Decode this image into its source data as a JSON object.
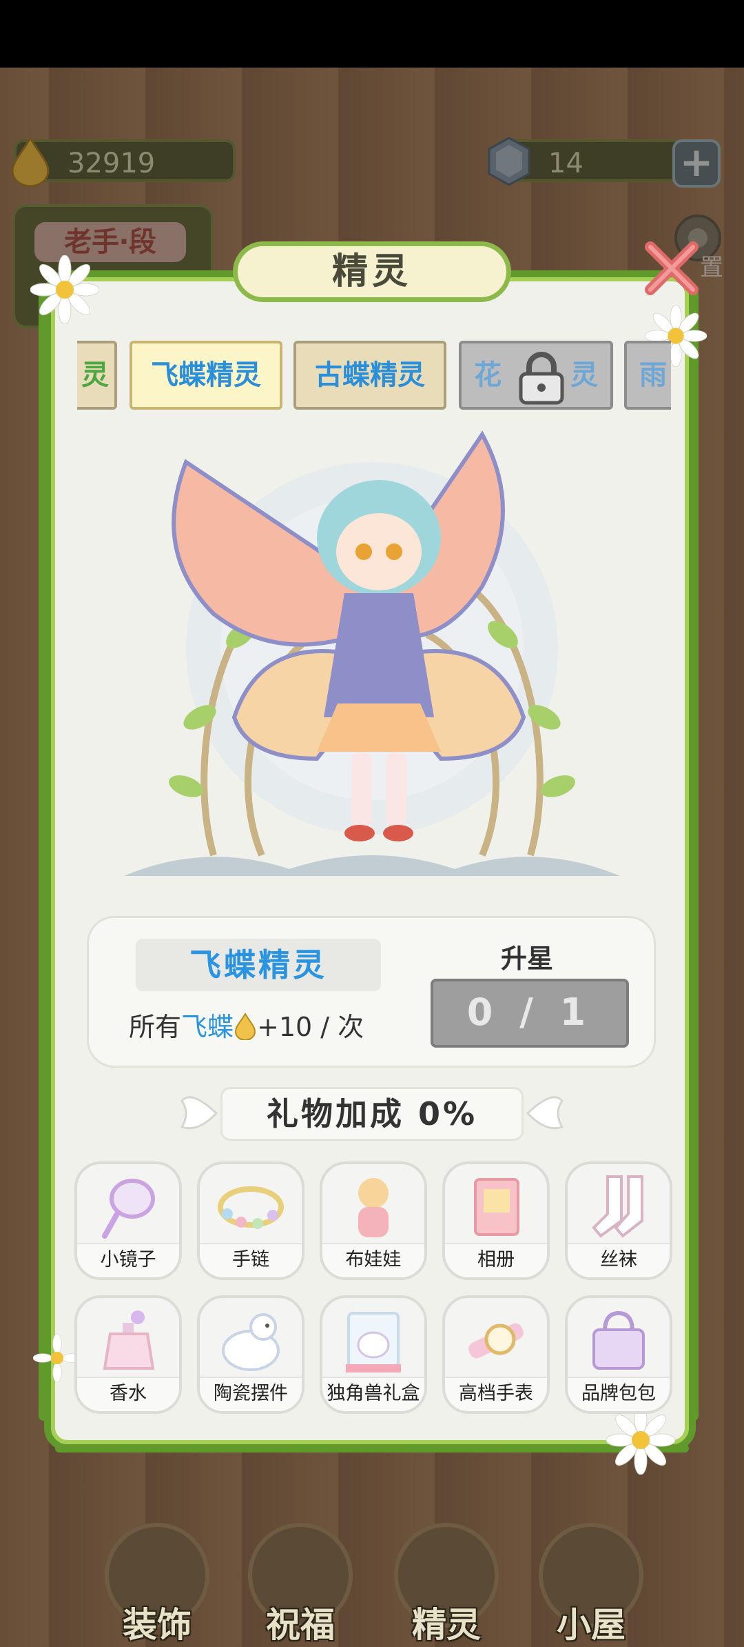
{
  "hud": {
    "gold_value": "32919",
    "gem_value": "14",
    "plus_label": "+",
    "banner_label": "老手",
    "banner_label_suffix": "段",
    "settings_label": "置"
  },
  "panel": {
    "title": "精灵",
    "tabs": [
      {
        "label": "灵",
        "state": "partial"
      },
      {
        "label": "飞蝶精灵",
        "state": "active"
      },
      {
        "label": "古蝶精灵",
        "state": "normal"
      },
      {
        "label": "花",
        "label_end": "灵",
        "state": "locked"
      },
      {
        "label": "雨",
        "state": "partial"
      }
    ]
  },
  "info": {
    "name": "飞蝶精灵",
    "bonus_prefix": "所有",
    "bonus_target": "飞蝶",
    "bonus_suffix": "+10 / 次",
    "star_label": "升星",
    "star_progress": "0 / 1"
  },
  "gifts": {
    "header": "礼物加成 0%",
    "items": [
      {
        "label": "小镜子",
        "icon": "mirror-icon"
      },
      {
        "label": "手链",
        "icon": "bracelet-icon"
      },
      {
        "label": "布娃娃",
        "icon": "doll-icon"
      },
      {
        "label": "相册",
        "icon": "album-icon"
      },
      {
        "label": "丝袜",
        "icon": "stockings-icon"
      },
      {
        "label": "香水",
        "icon": "perfume-icon"
      },
      {
        "label": "陶瓷摆件",
        "icon": "ceramic-ornament-icon"
      },
      {
        "label": "独角兽礼盒",
        "icon": "unicorn-giftbox-icon"
      },
      {
        "label": "高档手表",
        "icon": "watch-icon"
      },
      {
        "label": "品牌包包",
        "icon": "handbag-icon"
      }
    ]
  },
  "nav": [
    {
      "label": "装饰",
      "icon": "plant-icon"
    },
    {
      "label": "祝福",
      "icon": "butterfly-icon"
    },
    {
      "label": "精灵",
      "icon": "fairy-icon"
    },
    {
      "label": "小屋",
      "icon": "house-icon"
    }
  ],
  "colors": {
    "vine_green": "#5f9a2a",
    "name_blue": "#2b94e0",
    "panel_bg": "#f1f1ec"
  }
}
